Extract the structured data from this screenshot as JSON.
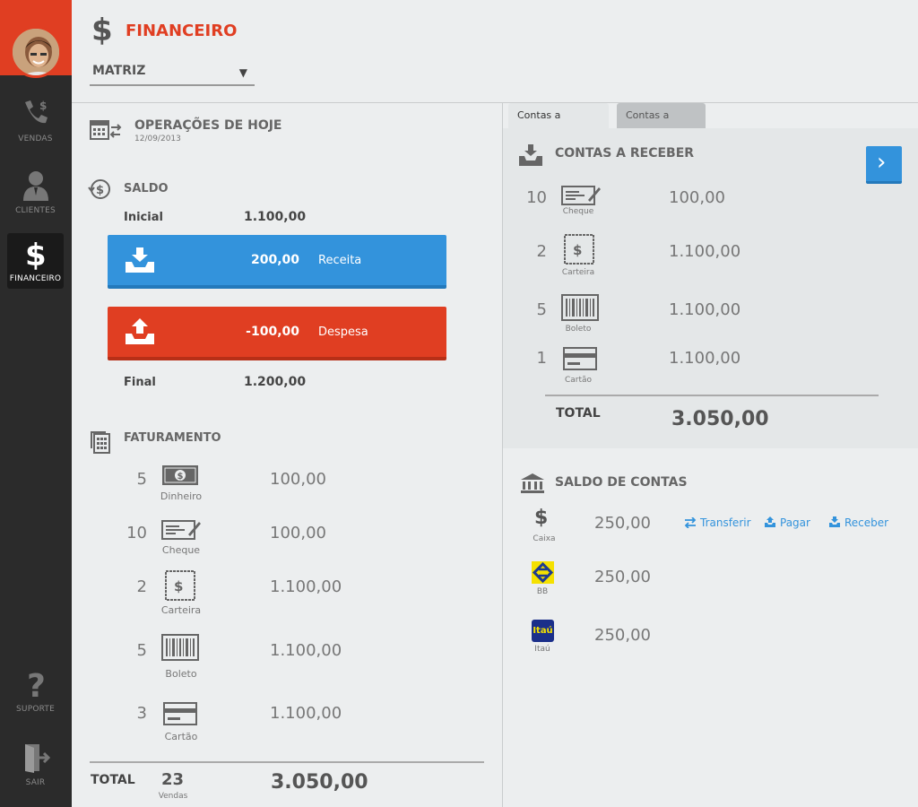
{
  "sidebar": {
    "items": [
      {
        "label": "VENDAS",
        "icon": "phone-dollar-icon"
      },
      {
        "label": "CLIENTES",
        "icon": "person-icon"
      },
      {
        "label": "FINANCEIRO",
        "icon": "dollar-icon"
      },
      {
        "label": "SUPORTE",
        "icon": "question-icon"
      },
      {
        "label": "SAIR",
        "icon": "exit-door-icon"
      }
    ]
  },
  "header": {
    "icon_glyph": "$",
    "title": "FINANCEIRO",
    "branch_select": "MATRIZ"
  },
  "operacoes": {
    "title": "OPERAÇÕES DE HOJE",
    "date": "12/09/2013"
  },
  "saldo": {
    "title": "SALDO",
    "initial_label": "Inicial",
    "initial_value": "1.100,00",
    "receita_amount": "200,00",
    "receita_label": "Receita",
    "despesa_amount": "-100,00",
    "despesa_label": "Despesa",
    "final_label": "Final",
    "final_value": "1.200,00"
  },
  "faturamento": {
    "title": "FATURAMENTO",
    "rows": [
      {
        "count": "5",
        "label": "Dinheiro",
        "value": "100,00",
        "icon": "cash-icon"
      },
      {
        "count": "10",
        "label": "Cheque",
        "value": "100,00",
        "icon": "cheque-icon"
      },
      {
        "count": "2",
        "label": "Carteira",
        "value": "1.100,00",
        "icon": "wallet-note-icon"
      },
      {
        "count": "5",
        "label": "Boleto",
        "value": "1.100,00",
        "icon": "barcode-icon"
      },
      {
        "count": "3",
        "label": "Cartão",
        "value": "1.100,00",
        "icon": "credit-card-icon"
      }
    ],
    "total_label": "TOTAL",
    "total_count": "23",
    "total_count_label": "Vendas",
    "total_value": "3.050,00"
  },
  "tabs": [
    "Contas a receber",
    "Contas a pagar"
  ],
  "receber": {
    "title": "CONTAS A RECEBER",
    "rows": [
      {
        "count": "10",
        "label": "Cheque",
        "value": "100,00",
        "icon": "cheque-icon"
      },
      {
        "count": "2",
        "label": "Carteira",
        "value": "1.100,00",
        "icon": "wallet-note-icon"
      },
      {
        "count": "5",
        "label": "Boleto",
        "value": "1.100,00",
        "icon": "barcode-icon"
      },
      {
        "count": "1",
        "label": "Cartão",
        "value": "1.100,00",
        "icon": "credit-card-icon"
      }
    ],
    "total_label": "TOTAL",
    "total_value": "3.050,00"
  },
  "saldo_contas": {
    "title": "SALDO DE CONTAS",
    "accounts": [
      {
        "label": "Caixa",
        "value": "250,00",
        "glyph": "$"
      },
      {
        "label": "BB",
        "value": "250,00"
      },
      {
        "label": "Itaú",
        "value": "250,00",
        "logo_text": "Itaú"
      }
    ],
    "actions": [
      "Transferir",
      "Pagar",
      "Receber"
    ]
  },
  "colors": {
    "accent_red": "#e03e22",
    "accent_blue": "#3393dc",
    "sidebar_bg": "#2b2b2b"
  }
}
